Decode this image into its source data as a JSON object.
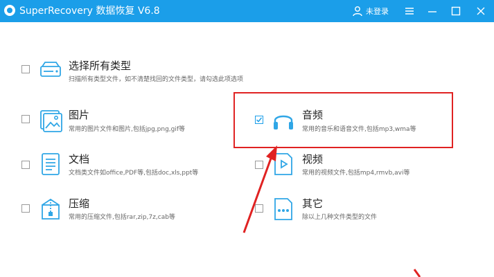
{
  "window": {
    "title": "SuperRecovery 数据恢复 V6.8",
    "login_label": "未登录"
  },
  "options": [
    {
      "title": "选择所有类型",
      "desc": "扫描所有类型文件，如不清楚找回的文件类型，请勾选此项选项",
      "checked": false,
      "icon": "drive-icon"
    },
    {
      "title": "图片",
      "desc": "常用的图片文件和图片,包括jpg,png,gif等",
      "checked": false,
      "icon": "image-icon"
    },
    {
      "title": "音频",
      "desc": "常用的音乐和语音文件,包括mp3,wma等",
      "checked": true,
      "icon": "headphones-icon"
    },
    {
      "title": "文档",
      "desc": "文档类文件如office,PDF等,包括doc,xls,ppt等",
      "checked": false,
      "icon": "document-icon"
    },
    {
      "title": "视频",
      "desc": "常用的视频文件,包括mp4,rmvb,avi等",
      "checked": false,
      "icon": "video-icon"
    },
    {
      "title": "压缩",
      "desc": "常用的压缩文件,包括rar,zip,7z,cab等",
      "checked": false,
      "icon": "archive-icon"
    },
    {
      "title": "其它",
      "desc": "除以上几种文件类型的文件",
      "checked": false,
      "icon": "more-icon"
    }
  ],
  "colors": {
    "titlebar": "#1b9ee9",
    "icon_accent": "#2fa6e6",
    "annotation": "#e02222"
  }
}
